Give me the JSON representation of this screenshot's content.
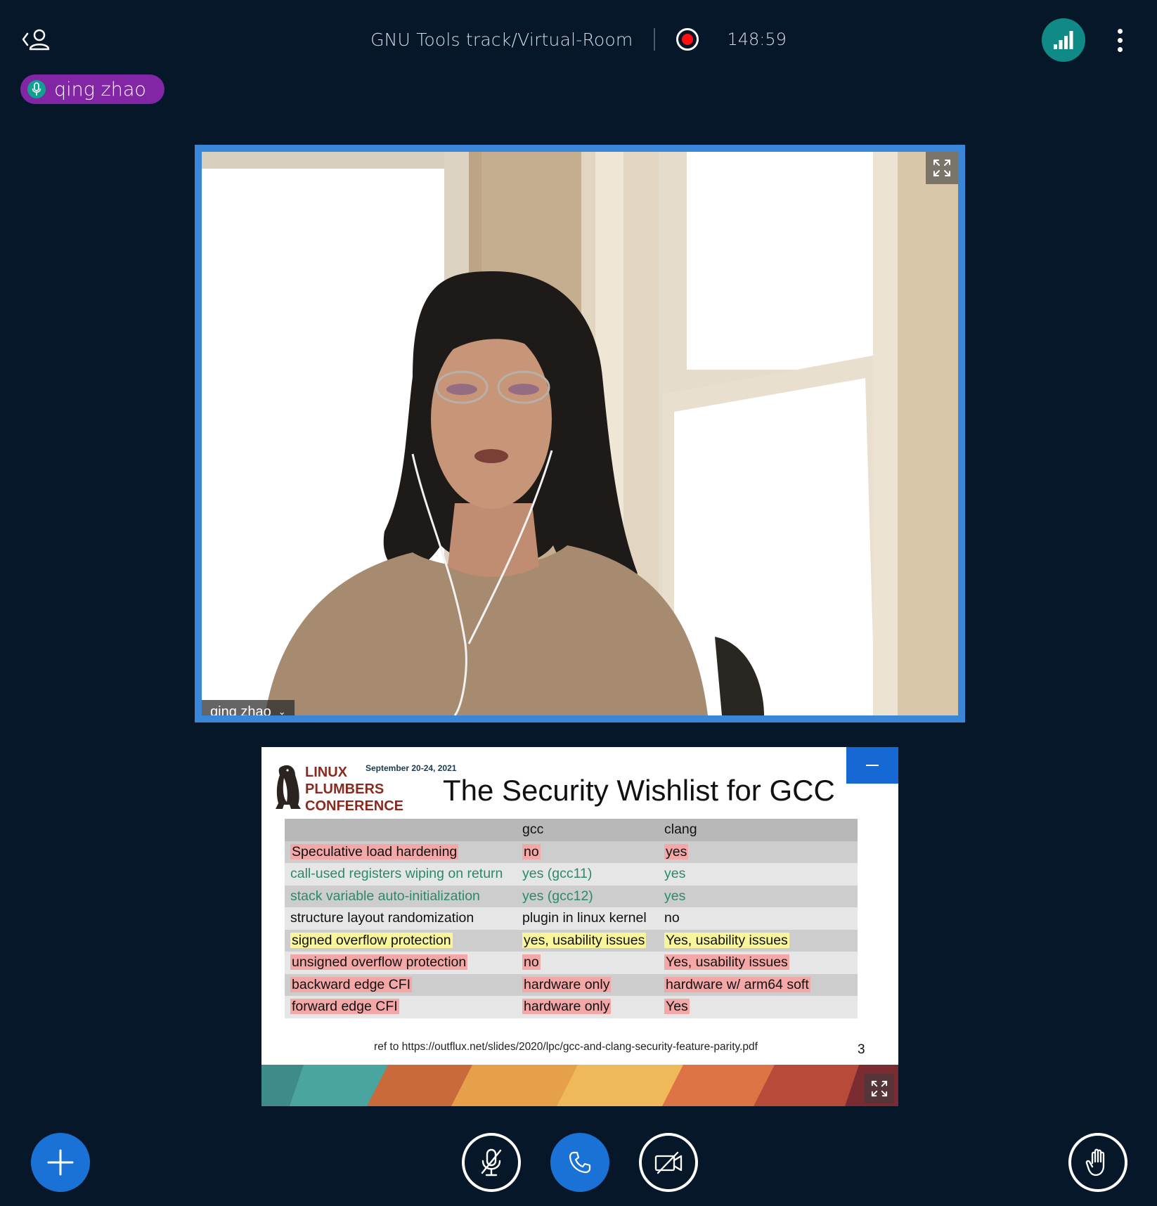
{
  "header": {
    "meeting_title": "GNU Tools track/Virtual-Room",
    "recording_time": "148:59"
  },
  "talking_indicator": {
    "name": "qing zhao"
  },
  "webcam": {
    "user_label": "qing zhao"
  },
  "presentation": {
    "logo_text": [
      "LINUX",
      "PLUMBERS",
      "CONFERENCE"
    ],
    "date": "September 20-24, 2021",
    "title": "The Security Wishlist for GCC",
    "table": {
      "headers": [
        "",
        "gcc",
        "clang"
      ],
      "rows": [
        [
          "Speculative load hardening",
          "no",
          "yes"
        ],
        [
          "call-used registers wiping on return",
          "yes (gcc11)",
          "yes"
        ],
        [
          "stack variable auto-initialization",
          "yes (gcc12)",
          "yes"
        ],
        [
          "structure layout randomization",
          "plugin in linux kernel",
          "no"
        ],
        [
          "signed overflow protection",
          "yes, usability issues",
          "Yes, usability issues"
        ],
        [
          "unsigned overflow protection",
          "no",
          "Yes, usability issues"
        ],
        [
          "backward edge CFI",
          "hardware only",
          "hardware w/ arm64 soft"
        ],
        [
          "forward edge CFI",
          "hardware only",
          "Yes"
        ]
      ]
    },
    "reference": "ref to https://outflux.net/slides/2020/lpc/gcc-and-clang-security-feature-parity.pdf",
    "page_number": "3"
  },
  "colors": {
    "background": "#06172a",
    "accent_blue": "#1a72d6",
    "talking_purple": "#8326a6",
    "connection_teal": "#0f8a86",
    "recording_red": "#ff1010",
    "webcam_border": "#3a86d8"
  },
  "icons": {
    "users": "user-list-icon",
    "recording": "record-icon",
    "connection": "signal-bars-icon",
    "more": "vertical-dots-icon",
    "actions": "plus-icon",
    "mute": "microphone-muted-icon",
    "audio": "phone-icon",
    "video": "camera-off-icon",
    "raise_hand": "hand-icon",
    "fullscreen": "expand-icon"
  }
}
